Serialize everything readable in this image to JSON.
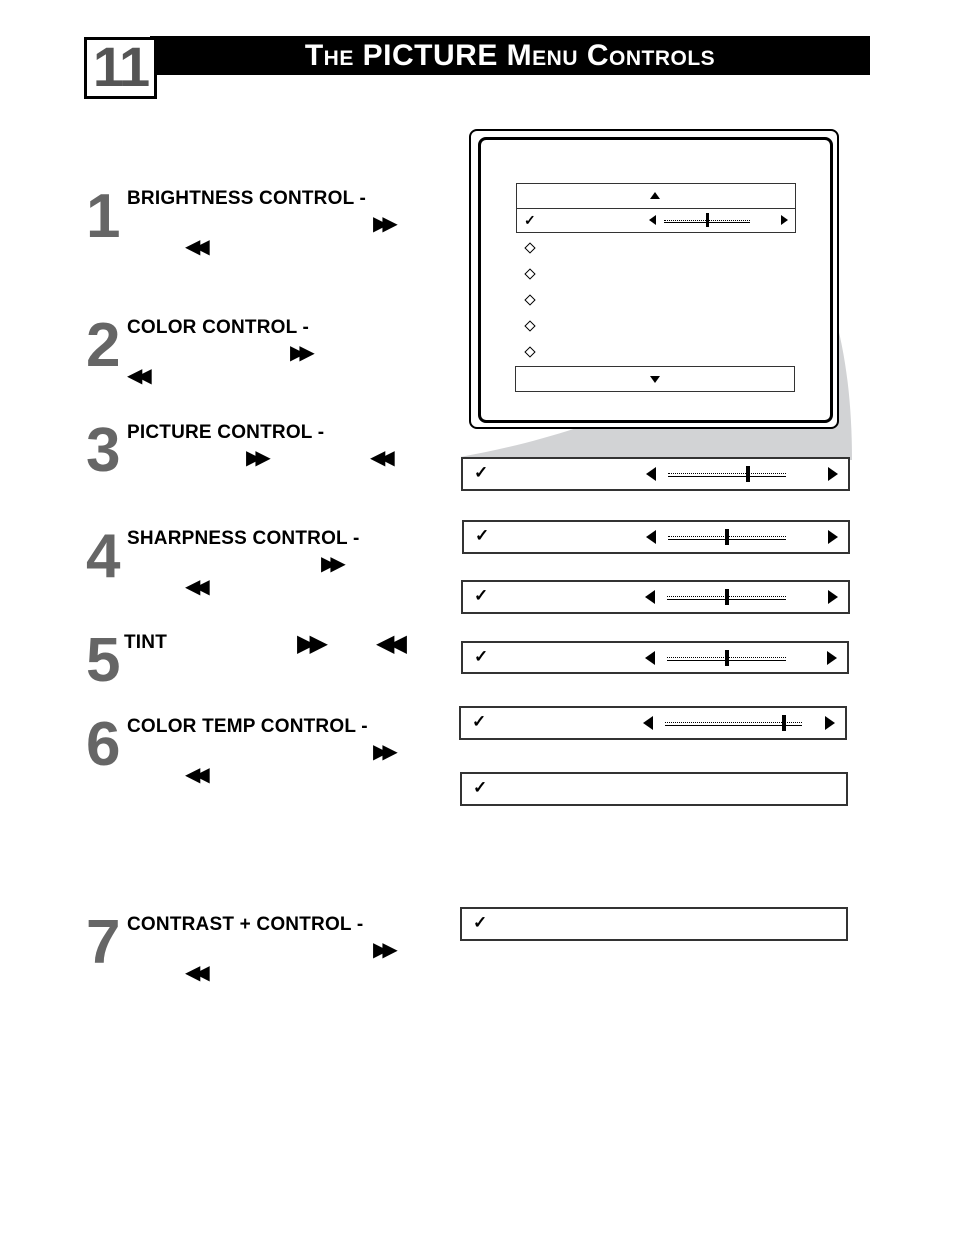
{
  "header": {
    "page_number": "11",
    "title": "The PICTURE Menu Controls"
  },
  "steps": [
    {
      "number": "1",
      "label": "BRIGHTNESS CONTROL -",
      "icons": [
        "fast-forward",
        "rewind"
      ]
    },
    {
      "number": "2",
      "label": "COLOR CONTROL -",
      "icons": [
        "fast-forward",
        "rewind"
      ]
    },
    {
      "number": "3",
      "label": "PICTURE CONTROL -",
      "icons": [
        "fast-forward",
        "rewind"
      ]
    },
    {
      "number": "4",
      "label": "SHARPNESS CONTROL -",
      "icons": [
        "fast-forward",
        "rewind"
      ]
    },
    {
      "number": "5",
      "label": "TINT",
      "icons": [
        "fast-forward",
        "rewind"
      ]
    },
    {
      "number": "6",
      "label": "COLOR TEMP CONTROL -",
      "icons": [
        "fast-forward",
        "rewind"
      ]
    },
    {
      "number": "7",
      "label": "CONTRAST + CONTROL -",
      "icons": [
        "fast-forward",
        "rewind"
      ]
    }
  ],
  "glyphs": {
    "fast_forward": "▶▶",
    "rewind": "◀◀",
    "check": "✓"
  },
  "tv_menu": {
    "selected_slider_value": 0.5,
    "unselected_items_count": 5
  },
  "setting_rows": [
    {
      "name": "brightness",
      "has_slider": true,
      "value": 0.68
    },
    {
      "name": "color",
      "has_slider": true,
      "value": 0.5
    },
    {
      "name": "picture",
      "has_slider": true,
      "value": 0.5
    },
    {
      "name": "sharpness",
      "has_slider": true,
      "value": 0.5
    },
    {
      "name": "tint",
      "has_slider": true,
      "value": 0.87
    },
    {
      "name": "color-temp",
      "has_slider": false
    },
    {
      "name": "contrast-plus",
      "has_slider": false
    }
  ]
}
